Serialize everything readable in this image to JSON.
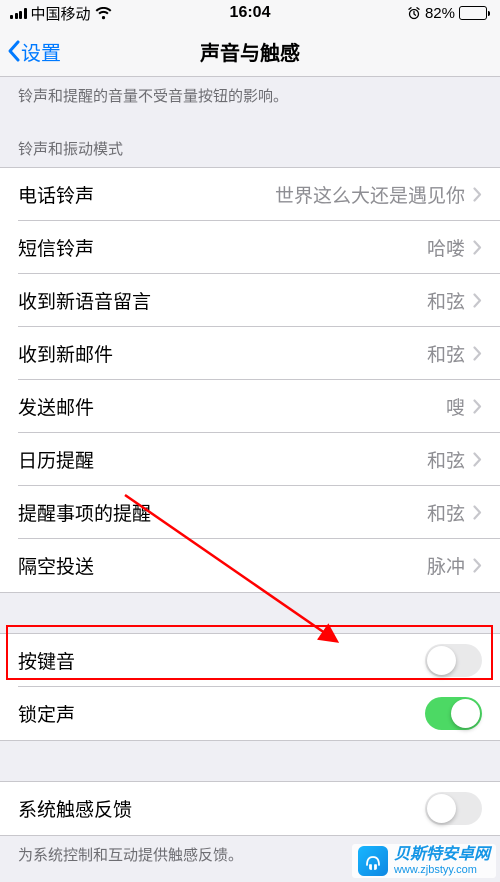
{
  "status": {
    "carrier": "中国移动",
    "time": "16:04",
    "battery_pct": "82%"
  },
  "nav": {
    "back_label": "设置",
    "title": "声音与触感"
  },
  "footer_top": "铃声和提醒的音量不受音量按钮的影响。",
  "section1_header": "铃声和振动模式",
  "ringtone_items": [
    {
      "label": "电话铃声",
      "value": "世界这么大还是遇见你"
    },
    {
      "label": "短信铃声",
      "value": "哈喽"
    },
    {
      "label": "收到新语音留言",
      "value": "和弦"
    },
    {
      "label": "收到新邮件",
      "value": "和弦"
    },
    {
      "label": "发送邮件",
      "value": "嗖"
    },
    {
      "label": "日历提醒",
      "value": "和弦"
    },
    {
      "label": "提醒事项的提醒",
      "value": "和弦"
    },
    {
      "label": "隔空投送",
      "value": "脉冲"
    }
  ],
  "toggle_items": [
    {
      "label": "按键音",
      "on": false
    },
    {
      "label": "锁定声",
      "on": true
    }
  ],
  "haptic": {
    "label": "系统触感反馈",
    "on": false
  },
  "footer_bottom": "为系统控制和互动提供触感反馈。",
  "watermark": {
    "name": "贝斯特安卓网",
    "url": "www.zjbstyy.com"
  }
}
